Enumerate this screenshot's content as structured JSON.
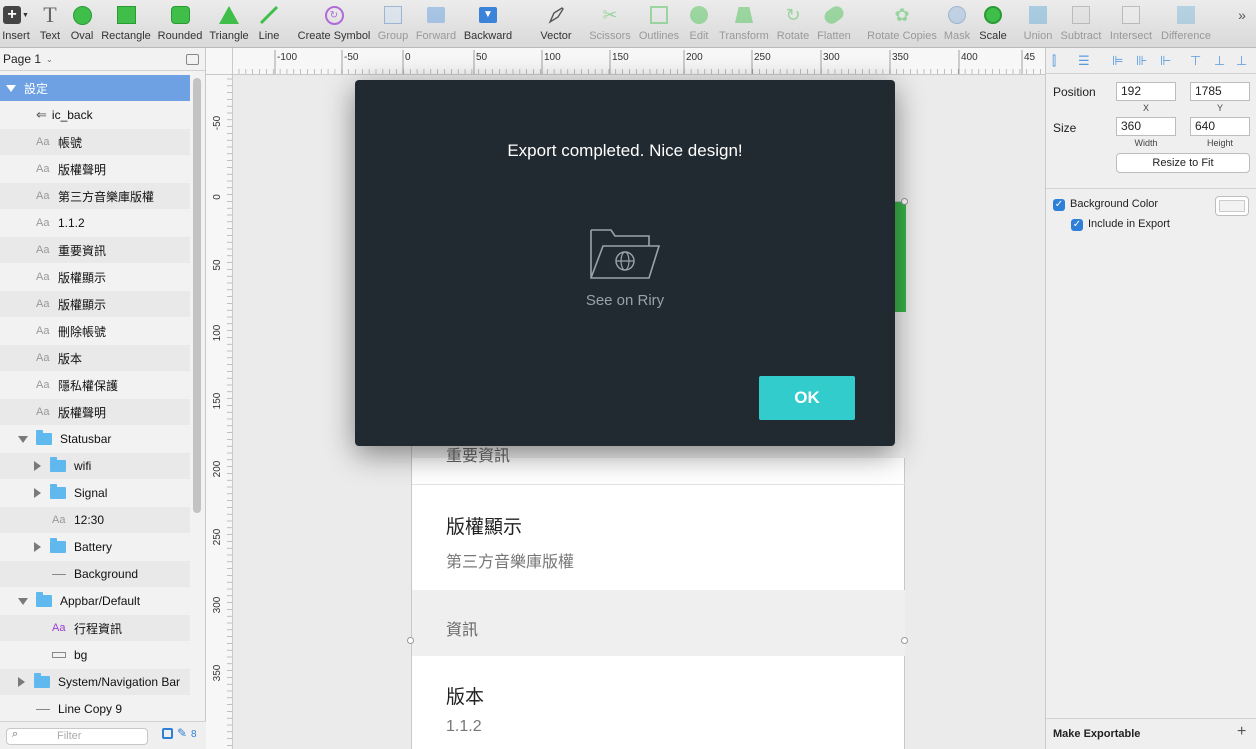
{
  "toolbar": {
    "insert": "Insert",
    "text": "Text",
    "oval": "Oval",
    "rectangle": "Rectangle",
    "rounded": "Rounded",
    "triangle": "Triangle",
    "line": "Line",
    "create_symbol": "Create Symbol",
    "group": "Group",
    "forward": "Forward",
    "backward": "Backward",
    "vector": "Vector",
    "scissors": "Scissors",
    "outlines": "Outlines",
    "edit": "Edit",
    "transform": "Transform",
    "rotate": "Rotate",
    "flatten": "Flatten",
    "rotate_copies": "Rotate Copies",
    "mask": "Mask",
    "scale": "Scale",
    "union": "Union",
    "subtract": "Subtract",
    "intersect": "Intersect",
    "difference": "Difference"
  },
  "layers": {
    "page": "Page 1",
    "items": [
      {
        "label": "設定"
      },
      {
        "label": "ic_back"
      },
      {
        "label": "帳號"
      },
      {
        "label": "版權聲明"
      },
      {
        "label": "第三方音樂庫版權"
      },
      {
        "label": "1.1.2"
      },
      {
        "label": "重要資訊"
      },
      {
        "label": "版權顯示"
      },
      {
        "label": "版權顯示"
      },
      {
        "label": "刪除帳號"
      },
      {
        "label": "版本"
      },
      {
        "label": "隱私權保護"
      },
      {
        "label": "版權聲明"
      },
      {
        "label": "Statusbar"
      },
      {
        "label": "wifi"
      },
      {
        "label": "Signal"
      },
      {
        "label": "12:30"
      },
      {
        "label": "Battery"
      },
      {
        "label": "Background"
      },
      {
        "label": "Appbar/Default"
      },
      {
        "label": "行程資訊"
      },
      {
        "label": "bg"
      },
      {
        "label": "System/Navigation Bar"
      },
      {
        "label": "Line Copy 9"
      }
    ],
    "aa": "Aa",
    "filter_placeholder": "Filter",
    "count": "8"
  },
  "rulers": {
    "h": [
      "-100",
      "-50",
      "0",
      "50",
      "100",
      "150",
      "200",
      "250",
      "300",
      "350",
      "400",
      "45"
    ],
    "v": [
      "-50",
      "0",
      "50",
      "100",
      "150",
      "200",
      "250",
      "300",
      "350"
    ]
  },
  "artboard": {
    "partial_text": "重要資訊",
    "row1_title": "版權顯示",
    "row1_sub": "第三方音樂庫版權",
    "section": "資訊",
    "row2_title": "版本",
    "row2_sub": "1.1.2"
  },
  "inspector": {
    "position_label": "Position",
    "x_value": "192",
    "y_value": "1785",
    "x_label": "X",
    "y_label": "Y",
    "size_label": "Size",
    "width_value": "360",
    "height_value": "640",
    "width_label": "Width",
    "height_label": "Height",
    "resize_button": "Resize to Fit",
    "bg_color_label": "Background Color",
    "include_export_label": "Include in Export",
    "make_exportable": "Make Exportable"
  },
  "dialog": {
    "title": "Export completed. Nice design!",
    "link": "See on Riry",
    "ok": "OK"
  },
  "colors": {
    "dialog_bg": "#222a31",
    "ok_button": "#33cccc",
    "selection": "#6da1e3",
    "green_accent": "#39b54a"
  }
}
